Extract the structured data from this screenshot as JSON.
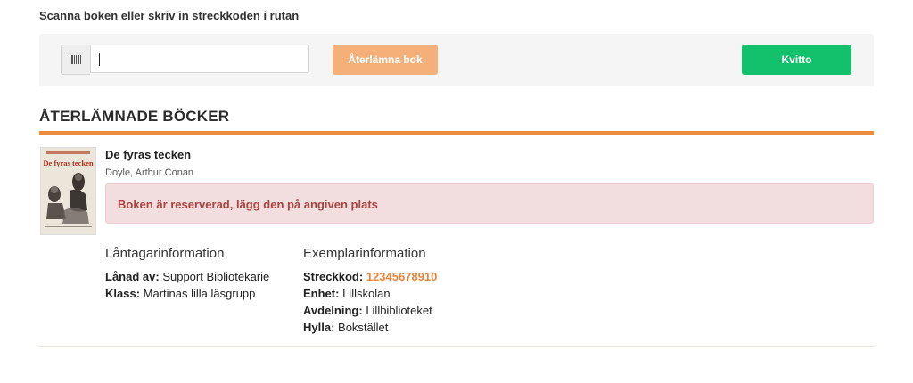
{
  "instruction": "Scanna boken eller skriv in streckkoden i rutan",
  "scan": {
    "input_value": "",
    "return_button": "Återlämna bok",
    "receipt_button": "Kvitto"
  },
  "section": {
    "title": "ÅTERLÄMNADE BÖCKER"
  },
  "book": {
    "title": "De fyras tecken",
    "author": "Doyle, Arthur Conan",
    "cover_title": "De fyras tecken",
    "alert": "Boken är reserverad, lägg den på angiven plats"
  },
  "borrower": {
    "heading": "Låntagarinformation",
    "borrowed_by_label": "Lånad av:",
    "borrowed_by": "Support Bibliotekarie",
    "class_label": "Klass:",
    "class": "Martinas lilla läsgrupp"
  },
  "copy": {
    "heading": "Exemplarinformation",
    "barcode_label": "Streckkod:",
    "barcode": "12345678910",
    "unit_label": "Enhet:",
    "unit": "Lillskolan",
    "department_label": "Avdelning:",
    "department": "Lillbiblioteket",
    "shelf_label": "Hylla:",
    "shelf": "Bokstället"
  },
  "colors": {
    "accent": "#ef8c3b",
    "return_button": "#f5b07a",
    "receipt_button": "#13c06b",
    "alert_bg": "#f2dede",
    "alert_text": "#a94442"
  },
  "icons": {
    "scan": "barcode-icon"
  }
}
